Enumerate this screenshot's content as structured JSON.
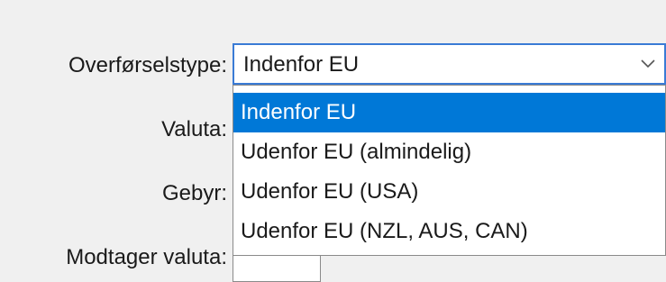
{
  "form": {
    "labels": {
      "transfer_type": "Overførselstype:",
      "currency": "Valuta:",
      "fee": "Gebyr:",
      "receiver_currency": "Modtager valuta:"
    },
    "transfer_type_combo": {
      "selected_value": "Indenfor EU",
      "icon": "chevron-down-icon",
      "options": [
        {
          "label": "Indenfor EU",
          "highlighted": true
        },
        {
          "label": "Udenfor EU (almindelig)",
          "highlighted": false
        },
        {
          "label": "Udenfor EU (USA)",
          "highlighted": false
        },
        {
          "label": "Udenfor EU (NZL, AUS, CAN)",
          "highlighted": false
        }
      ]
    }
  },
  "colors": {
    "background": "#f0f0f0",
    "focus_border": "#3a7bd5",
    "highlight": "#0078d7",
    "highlight_text": "#ffffff",
    "text": "#1a1a1a"
  }
}
